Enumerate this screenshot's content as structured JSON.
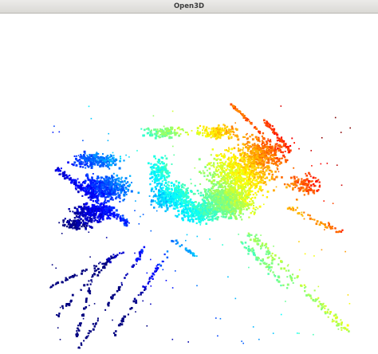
{
  "window": {
    "title": "Open3D"
  },
  "viewport": {
    "background_color": "#ffffff",
    "content": "point-cloud",
    "colormap": "jet"
  }
}
